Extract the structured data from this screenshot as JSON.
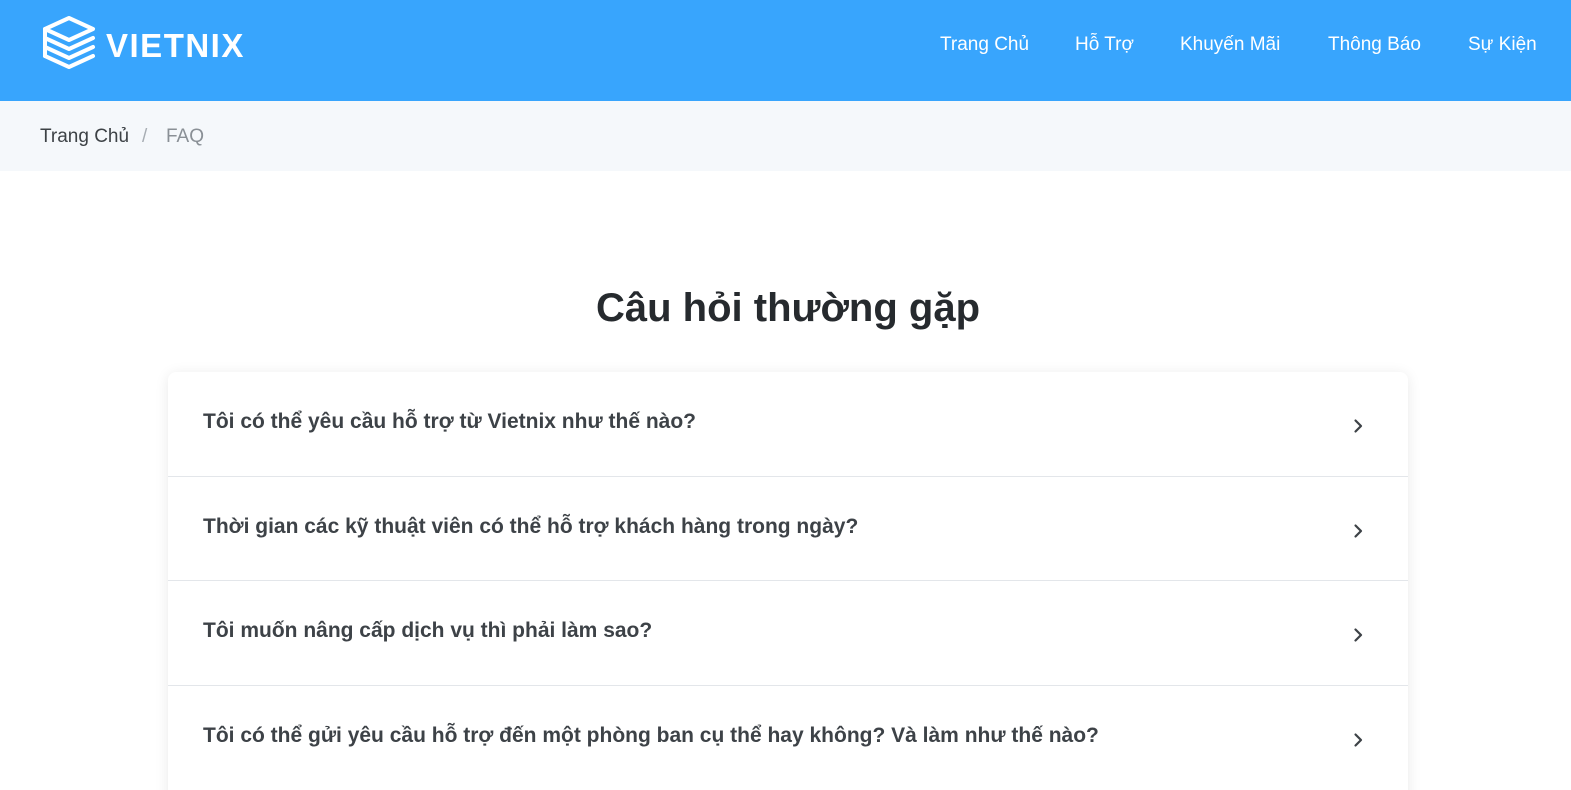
{
  "header": {
    "brand": "VIETNIX",
    "accent_color": "#38a5fd",
    "nav": [
      {
        "label": "Trang Chủ"
      },
      {
        "label": "Hỗ Trợ"
      },
      {
        "label": "Khuyến Mãi"
      },
      {
        "label": "Thông Báo"
      },
      {
        "label": "Sự Kiện"
      }
    ]
  },
  "breadcrumb": {
    "home": "Trang Chủ",
    "separator": "/",
    "current": "FAQ"
  },
  "page": {
    "title": "Câu hỏi thường gặp"
  },
  "faq": {
    "items": [
      {
        "question": "Tôi có thể yêu cầu hỗ trợ từ Vietnix như thế nào?",
        "icon": "chevron-right-icon"
      },
      {
        "question": "Thời gian các kỹ thuật viên có thể hỗ trợ khách hàng trong ngày?",
        "icon": "chevron-right-icon"
      },
      {
        "question": "Tôi muốn nâng cấp dịch vụ thì phải làm sao?",
        "icon": "chevron-right-icon"
      },
      {
        "question": "Tôi có thể gửi yêu cầu hỗ trợ đến một phòng ban cụ thể hay không? Và làm như thế nào?",
        "icon": "chevron-right-icon"
      }
    ]
  }
}
